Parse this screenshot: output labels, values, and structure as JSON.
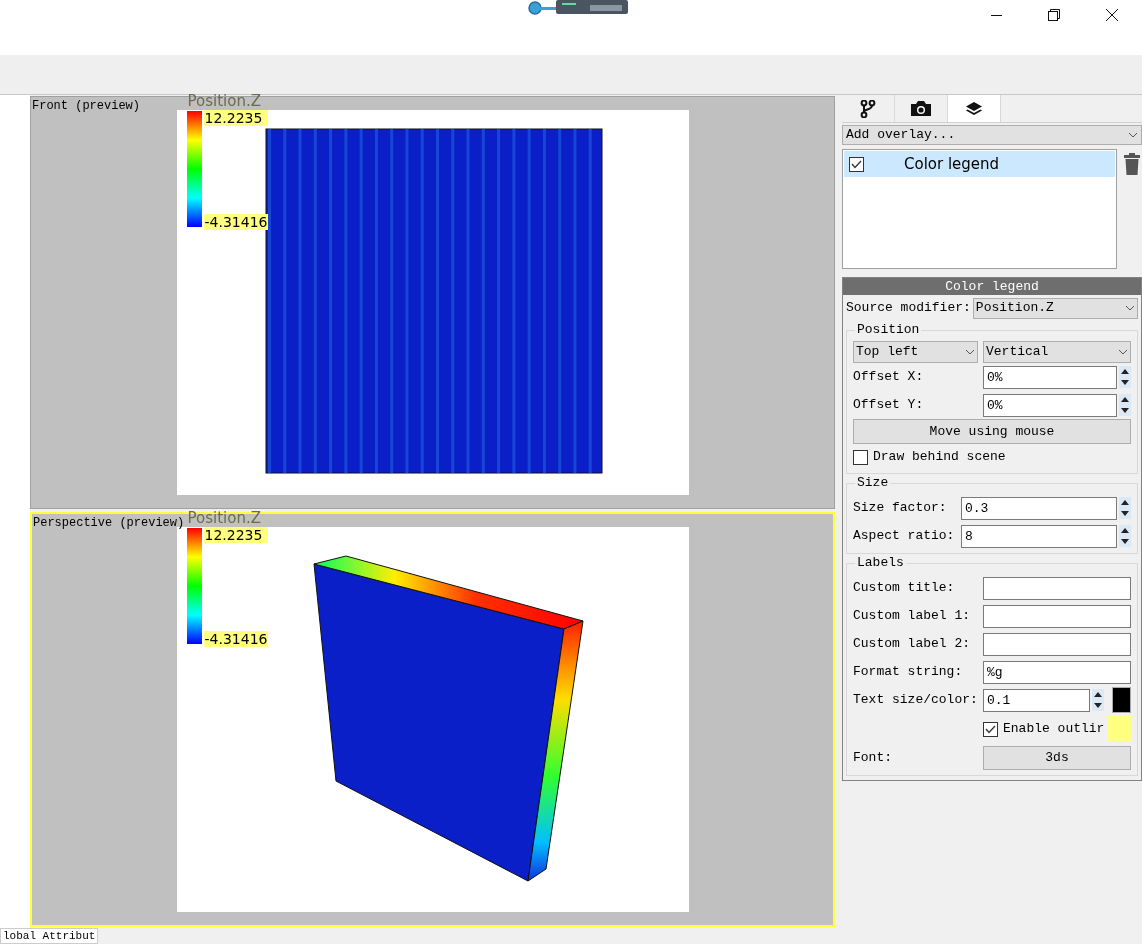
{
  "viewports": [
    {
      "kind": "front",
      "label": "Front (preview)",
      "active": false,
      "legend": {
        "title": "Position.Z",
        "max": "12.2235",
        "min": "-4.31416"
      }
    },
    {
      "kind": "perspective",
      "label": "Perspective (preview)",
      "active": true,
      "legend": {
        "title": "Position.Z",
        "max": "12.2235",
        "min": "-4.31416"
      }
    }
  ],
  "command_panel": {
    "tabs": [
      {
        "kind": "pipeline",
        "selected": false
      },
      {
        "kind": "render",
        "selected": false
      },
      {
        "kind": "overlays",
        "selected": true
      }
    ],
    "add_overlay": "Add overlay...",
    "overlays": [
      {
        "label": "Color legend",
        "checked": true,
        "selected": true
      }
    ],
    "editor": {
      "title": "Color legend",
      "source_modifier": {
        "label": "Source modifier:",
        "value": "Position.Z"
      },
      "position": {
        "title": "Position",
        "alignment": "Top left",
        "orientation": "Vertical",
        "offset_x": {
          "label": "Offset X:",
          "value": "0%"
        },
        "offset_y": {
          "label": "Offset Y:",
          "value": "0%"
        },
        "move_button": "Move using mouse",
        "draw_behind": {
          "label": "Draw behind scene",
          "checked": false
        }
      },
      "size": {
        "title": "Size",
        "size_factor": {
          "label": "Size factor:",
          "value": "0.3"
        },
        "aspect_ratio": {
          "label": "Aspect ratio:",
          "value": "8"
        }
      },
      "labels": {
        "title": "Labels",
        "fields": [
          {
            "label": "Custom title:"
          },
          {
            "label": "Custom label 1:"
          },
          {
            "label": "Custom label 2:"
          },
          {
            "label": "Format string:",
            "value": "%g"
          }
        ],
        "text_size": {
          "label": "Text size/color:",
          "value": "0.1",
          "color": "#000000"
        },
        "outline": {
          "label": "Enable outlir",
          "checked": true,
          "color": "#ffff80"
        },
        "font": {
          "label": "Font:",
          "button": "3ds"
        }
      }
    }
  },
  "bottom_tab": "lobal Attribut"
}
